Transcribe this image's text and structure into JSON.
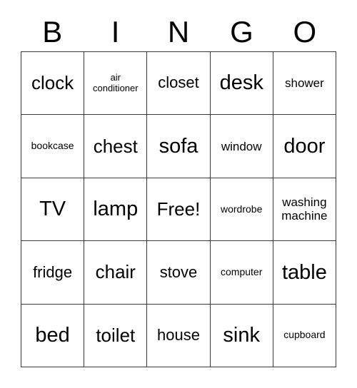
{
  "card": {
    "title": "BINGO",
    "header_letters": [
      "B",
      "I",
      "N",
      "G",
      "O"
    ],
    "grid_size": "5x5",
    "colors": {
      "background": "#ffffff",
      "text": "#000000",
      "gridline": "#3a3a3a"
    },
    "cells": [
      {
        "text": "clock",
        "size": "fs-lg",
        "col": "B",
        "row": 1
      },
      {
        "text": "air\nconditioner",
        "size": "fs-xxs",
        "col": "I",
        "row": 1
      },
      {
        "text": "closet",
        "size": "fs-md",
        "col": "N",
        "row": 1
      },
      {
        "text": "desk",
        "size": "fs-xl",
        "col": "G",
        "row": 1
      },
      {
        "text": "shower",
        "size": "fs-sm",
        "col": "O",
        "row": 1
      },
      {
        "text": "bookcase",
        "size": "fs-xs",
        "col": "B",
        "row": 2
      },
      {
        "text": "chest",
        "size": "fs-lg",
        "col": "I",
        "row": 2
      },
      {
        "text": "sofa",
        "size": "fs-xl",
        "col": "N",
        "row": 2
      },
      {
        "text": "window",
        "size": "fs-sm",
        "col": "G",
        "row": 2
      },
      {
        "text": "door",
        "size": "fs-xl",
        "col": "O",
        "row": 2
      },
      {
        "text": "TV",
        "size": "fs-xl",
        "col": "B",
        "row": 3
      },
      {
        "text": "lamp",
        "size": "fs-xl",
        "col": "I",
        "row": 3
      },
      {
        "text": "Free!",
        "size": "fs-lg",
        "col": "N",
        "row": 3
      },
      {
        "text": "wordrobe",
        "size": "fs-xs",
        "col": "G",
        "row": 3
      },
      {
        "text": "washing\nmachine",
        "size": "fs-sm",
        "col": "O",
        "row": 3
      },
      {
        "text": "fridge",
        "size": "fs-md",
        "col": "B",
        "row": 4
      },
      {
        "text": "chair",
        "size": "fs-lg",
        "col": "I",
        "row": 4
      },
      {
        "text": "stove",
        "size": "fs-md",
        "col": "N",
        "row": 4
      },
      {
        "text": "computer",
        "size": "fs-xs",
        "col": "G",
        "row": 4
      },
      {
        "text": "table",
        "size": "fs-xl",
        "col": "O",
        "row": 4
      },
      {
        "text": "bed",
        "size": "fs-xl",
        "col": "B",
        "row": 5
      },
      {
        "text": "toilet",
        "size": "fs-lg",
        "col": "I",
        "row": 5
      },
      {
        "text": "house",
        "size": "fs-md",
        "col": "N",
        "row": 5
      },
      {
        "text": "sink",
        "size": "fs-xl",
        "col": "G",
        "row": 5
      },
      {
        "text": "cupboard",
        "size": "fs-xs",
        "col": "O",
        "row": 5
      }
    ]
  }
}
